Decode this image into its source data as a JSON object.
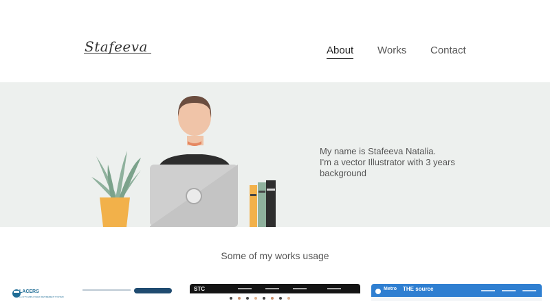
{
  "header": {
    "logo_text": "Stafeeva",
    "nav": [
      {
        "label": "About",
        "active": true
      },
      {
        "label": "Works",
        "active": false
      },
      {
        "label": "Contact",
        "active": false
      }
    ]
  },
  "hero": {
    "line1": "My name is Stafeeva Natalia.",
    "line2": "I'm a vector Illustrator with 3 years",
    "line3": "background"
  },
  "works": {
    "title": "Some of my works usage",
    "cards": [
      {
        "brand": "LACERS",
        "sub": "LA CITY EMPLOYEES' RETIREMENT SYSTEM"
      },
      {
        "brand": "STC"
      },
      {
        "brand": "Metro",
        "subbrand": "THE source"
      }
    ]
  },
  "colors": {
    "hero_bg": "#edf0ee",
    "text": "#555555",
    "lacers_blue": "#1f6d96",
    "metro_blue": "#2f7fd1",
    "stc_dark": "#141414"
  }
}
